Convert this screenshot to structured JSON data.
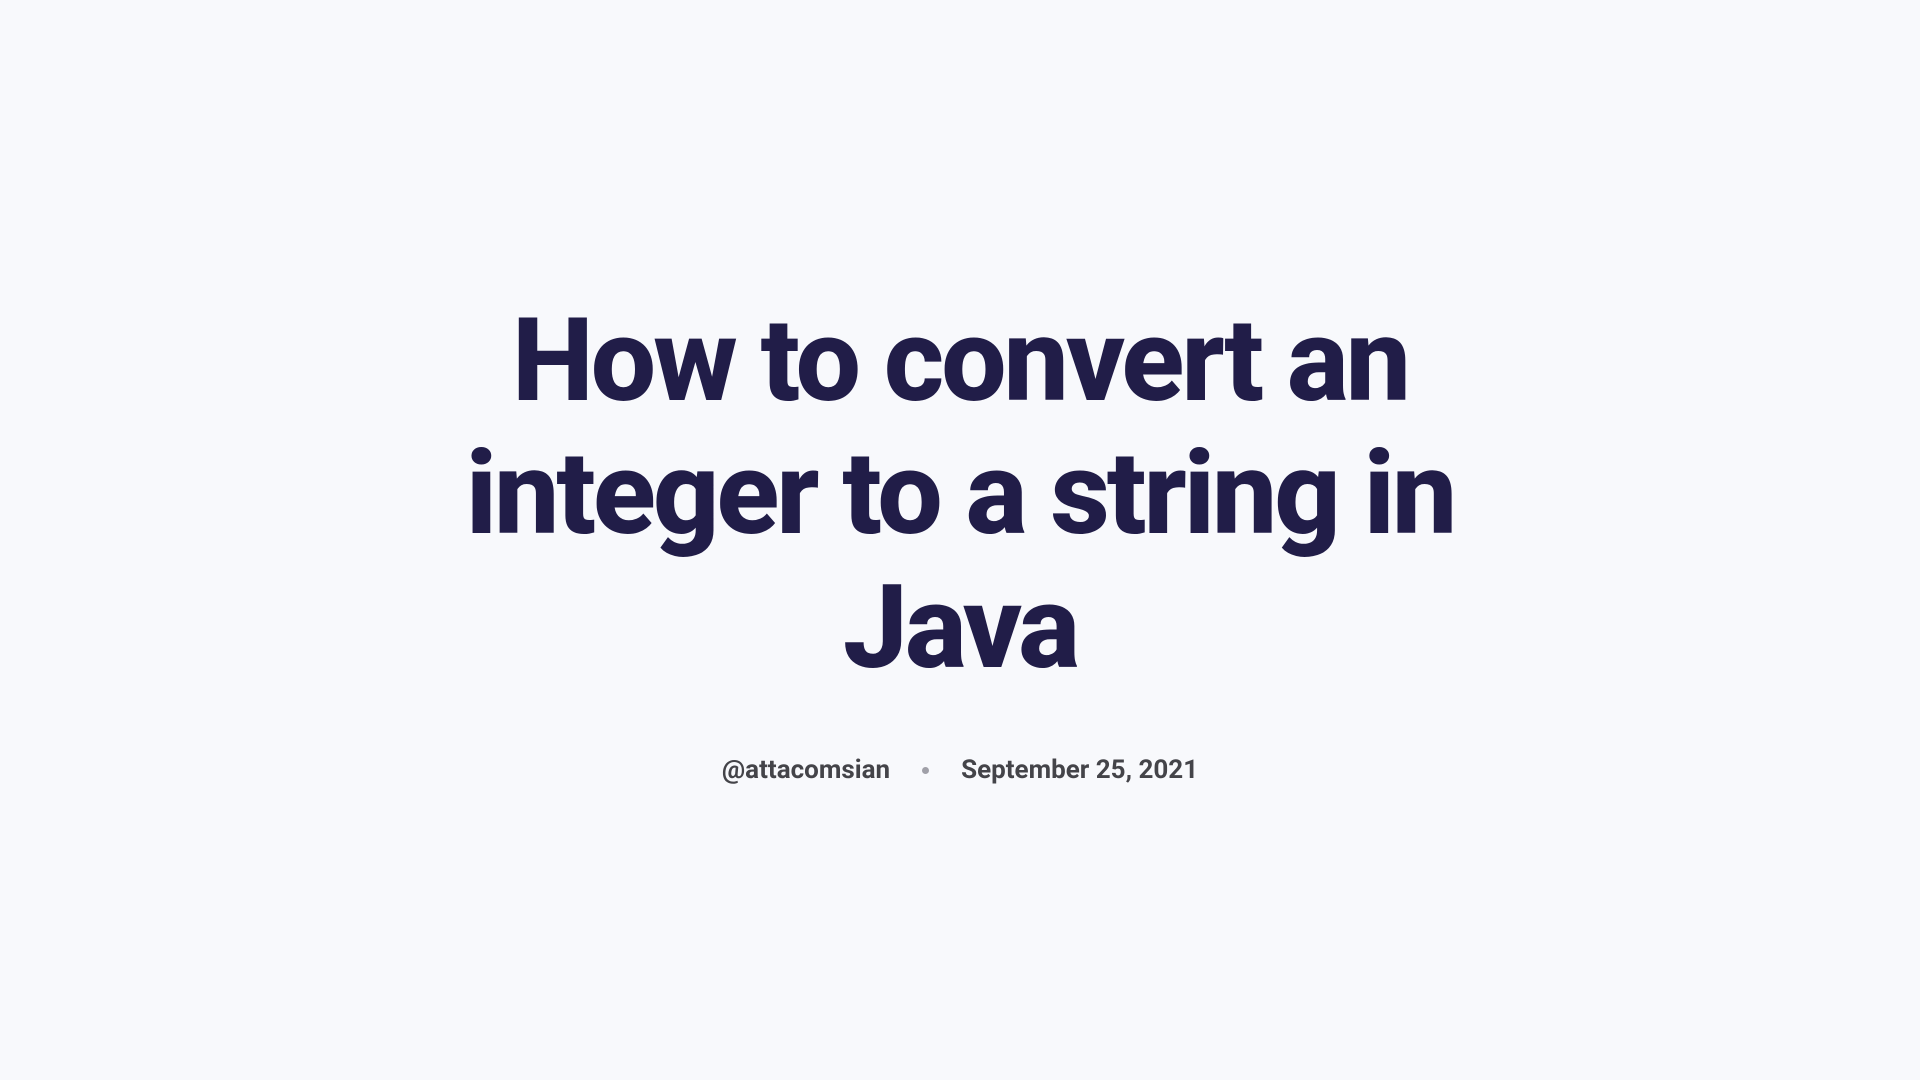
{
  "article": {
    "title": "How to convert an integer to a string in Java",
    "author": "@attacomsian",
    "date": "September 25, 2021"
  }
}
